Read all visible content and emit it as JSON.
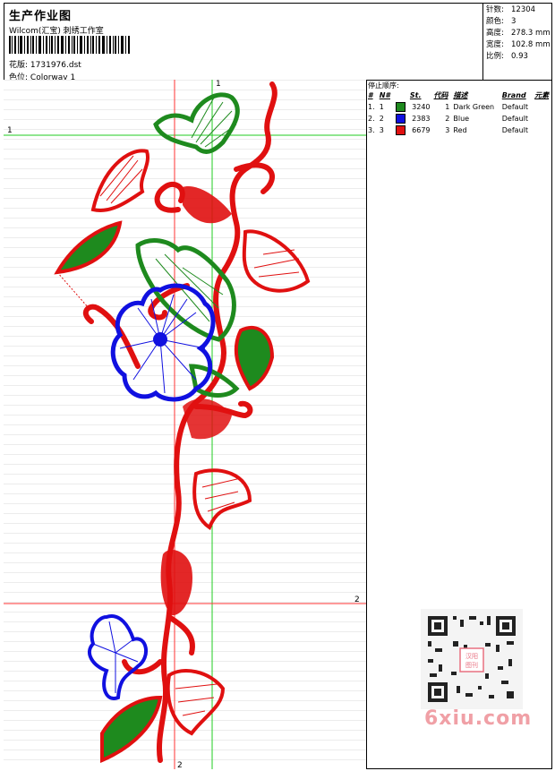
{
  "header": {
    "title": "生产作业图",
    "company": "Wilcom(汇宝) 刺绣工作室",
    "design_label": "花版:",
    "design_file": "1731976.dst",
    "colorway_label": "色位:",
    "colorway": "Colorway 1"
  },
  "info": {
    "stitches_label": "针数:",
    "stitches": "12304",
    "colors_label": "颜色:",
    "colors": "3",
    "height_label": "高度:",
    "height": "278.3 mm",
    "width_label": "宽度:",
    "width": "102.8 mm",
    "scale_label": "比例:",
    "scale": "0.93"
  },
  "sequence": {
    "label": "停止顺序:",
    "headers": [
      "#",
      "N#",
      "St.",
      "代码",
      "描述",
      "Brand",
      "元素"
    ],
    "rows": [
      {
        "idx": "1.",
        "n": "1",
        "color": "#1e8a1e",
        "st": "3240",
        "code": "1",
        "desc": "Dark Green",
        "brand": "Default"
      },
      {
        "idx": "2.",
        "n": "2",
        "color": "#1010e0",
        "st": "2383",
        "code": "2",
        "desc": "Blue",
        "brand": "Default"
      },
      {
        "idx": "3.",
        "n": "3",
        "color": "#e01010",
        "st": "6679",
        "code": "3",
        "desc": "Red",
        "brand": "Default"
      }
    ]
  },
  "canvas": {
    "markers": {
      "top": "1",
      "left": "1",
      "right": "2",
      "bottom": "2"
    }
  },
  "watermark": {
    "text": "6xiu.com",
    "seal": "汉阳图刊"
  },
  "colors": {
    "green": "#1e8a1e",
    "blue": "#1010e0",
    "red": "#e01010",
    "guide_green": "#22cc22",
    "guide_red": "#ff3333"
  }
}
